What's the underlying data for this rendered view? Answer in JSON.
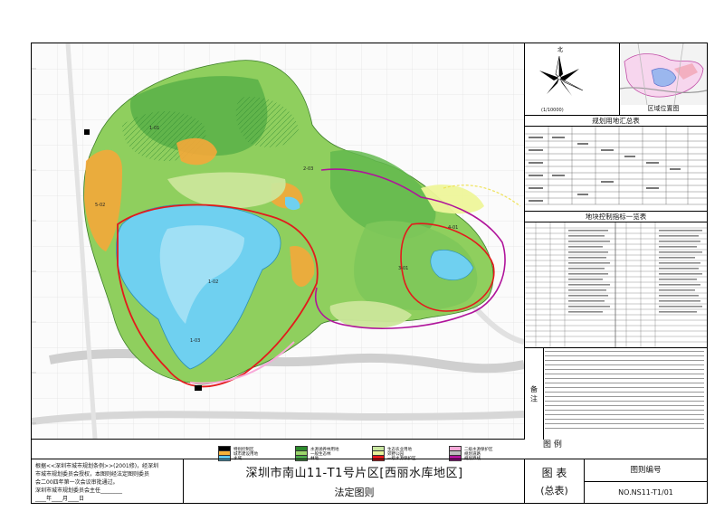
{
  "map": {
    "labels": [
      "1-01",
      "1-02",
      "1-03",
      "2-03",
      "3-01",
      "4-01",
      "5-02"
    ]
  },
  "north": {
    "symbol": "北",
    "scale": "(1/10000)"
  },
  "locator": {
    "caption": "区域位置图"
  },
  "table1": {
    "title": "规划用地汇总表"
  },
  "table2": {
    "title": "地块控制指标一览表"
  },
  "notes": {
    "side_label": "备 注"
  },
  "legend": {
    "title": "图 例",
    "items": [
      {
        "label": "特别控制区",
        "color": "#000000"
      },
      {
        "label": "城市建设用地",
        "color": "#f6b23a"
      },
      {
        "label": "水域",
        "color": "#5ec7ee"
      },
      {
        "label": "水源涵养林用地",
        "color": "#2c8a2c"
      },
      {
        "label": "一般生态林",
        "color": "#9bd66a"
      },
      {
        "label": "林地",
        "color": "#4ca64c"
      },
      {
        "label": "生态农业用地",
        "color": "#c8e6a0"
      },
      {
        "label": "郊野公园",
        "color": "#e7f49a"
      },
      {
        "label": "一级水源保护区",
        "color": "#e31a1c"
      },
      {
        "label": "二级水源保护区",
        "color": "#f8a9d8"
      },
      {
        "label": "规划道路",
        "color": "#bdbdbd"
      },
      {
        "label": "规划界线",
        "color": "#b0149b"
      }
    ]
  },
  "approval": {
    "lines": [
      "根据<<深圳市城市规划条例>>(2001修)，经深圳",
      "市城市规划委员会授权，本图则经法定图则委员",
      "会二00四年第一次会议审批通过。",
      "深圳市城市规划委员会主任________",
      "             ____年____月____日"
    ]
  },
  "title": {
    "main": "深圳市南山11-T1号片区[西丽水库地区]",
    "sub": "法定图则"
  },
  "sheet_type": {
    "main": "图 表",
    "sub": "(总表)"
  },
  "sheet_no": {
    "label": "图则编号",
    "value": "NO.NS11-T1/01"
  }
}
